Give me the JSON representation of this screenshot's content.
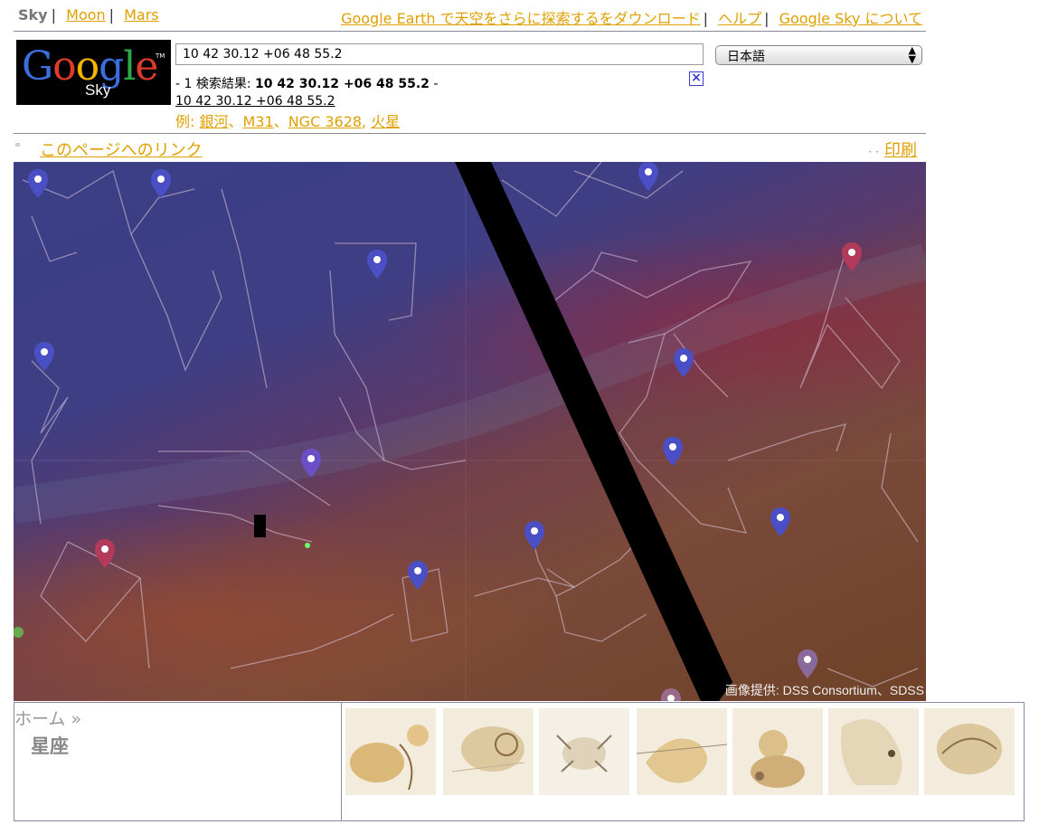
{
  "nav": {
    "sky": "Sky",
    "moon": "Moon",
    "mars": "Mars",
    "download": "Google Earth で天空をさらに探索するをダウンロード",
    "help": "ヘルプ",
    "about": "Google Sky について"
  },
  "logo": {
    "brand": "Google",
    "product": "Sky"
  },
  "search": {
    "value": "10 42 30.12 +06 48 55.2"
  },
  "language": {
    "selected": "日本語"
  },
  "results": {
    "prefix": "- 1 検索結果: ",
    "query": "10 42 30.12 +06 48 55.2",
    "suffix": " -",
    "link": "10 42 30.12 +06 48 55.2"
  },
  "examples": {
    "label": "例: ",
    "items": [
      "銀河",
      "M31",
      "NGC 3628",
      "火星"
    ]
  },
  "page_link": "このページへのリンク",
  "print": "印刷",
  "map": {
    "credit": "画像提供: DSS Consortium、SDSS"
  },
  "bottom": {
    "breadcrumb": "ホーム »",
    "title": "星座"
  },
  "colors": {
    "link": "#e0a000",
    "marker_blue": "#4a4fc6",
    "marker_red": "#b23a5a",
    "rule": "#8a8a9e"
  }
}
